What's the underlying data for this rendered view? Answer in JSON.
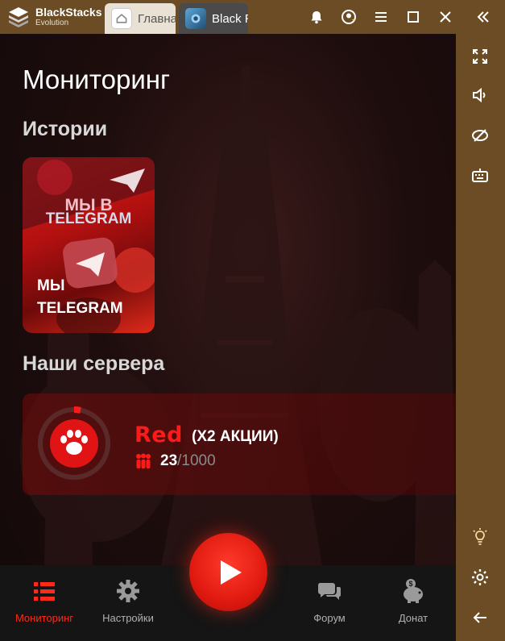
{
  "window": {
    "brand_name": "BlackStacks",
    "brand_sub": "Evolution",
    "tabs": [
      {
        "label": "Главная",
        "icon": "home-icon"
      },
      {
        "label": "Black Russia",
        "icon": "game-icon"
      }
    ],
    "actions": [
      "bell-icon",
      "account-icon",
      "menu-icon",
      "maximize-icon",
      "close-icon",
      "collapse-icon"
    ],
    "accent_color": "#6b4c25"
  },
  "sidebar": {
    "top": [
      "fullscreen-icon",
      "volume-icon",
      "hide-icon",
      "keyboard-icon"
    ],
    "bottom": [
      "brightness-icon",
      "settings-icon",
      "back-icon"
    ]
  },
  "app": {
    "title": "Мониторинг",
    "stories_heading": "Истории",
    "story": {
      "caption": "МЫ TELEGRAM",
      "art_text_1": "МЫ В",
      "art_text_2": "TELEGRAM"
    },
    "servers_heading": "Наши сервера",
    "server": {
      "name": "Red",
      "promo": "(X2 АКЦИИ)",
      "online": "23",
      "separator": "/",
      "max": "1000",
      "color": "#ff1a1a"
    },
    "nav": [
      {
        "label": "Мониторинг",
        "icon": "list-icon",
        "active": true
      },
      {
        "label": "Настройки",
        "icon": "gear-icon",
        "active": false
      },
      {
        "label": "Форум",
        "icon": "chat-icon",
        "active": false
      },
      {
        "label": "Донат",
        "icon": "piggy-bank-icon",
        "active": false
      }
    ],
    "play_icon": "play-icon"
  }
}
